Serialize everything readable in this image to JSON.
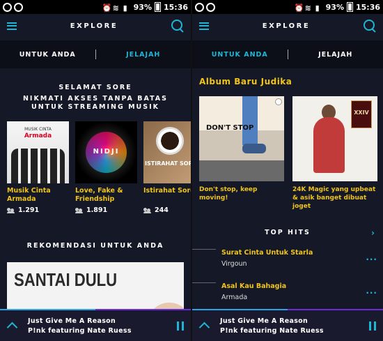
{
  "status_bar": {
    "battery": "93%",
    "time": "15:36"
  },
  "colors": {
    "accent": "#1fb6d6",
    "highlight": "#f0c419",
    "background": "#151826",
    "player_border": "#6c2cd8"
  },
  "left": {
    "topbar": {
      "title": "EXPLORE"
    },
    "tabs": [
      {
        "label": "UNTUK ANDA",
        "active": true
      },
      {
        "label": "JELAJAH",
        "active": false
      }
    ],
    "greeting": {
      "line1": "SELAMAT SORE",
      "line2": "NIKMATI AKSES TANPA BATAS UNTUK STREAMING MUSIK"
    },
    "playlists": [
      {
        "title": "Musik Cinta Armada",
        "followers": "1.291",
        "cover_text": "MUSIK CINTA",
        "cover_logo": "Armada"
      },
      {
        "title": "Love, Fake & Friendship",
        "followers": "1.891",
        "cover_text": "NIDJI"
      },
      {
        "title": "Istirahat Sore",
        "followers": "244",
        "cover_text": "ISTIRAHAT SORE"
      }
    ],
    "recommend": {
      "title": "REKOMENDASI UNTUK ANDA",
      "banner_text": "SANTAI DULU"
    }
  },
  "right": {
    "topbar": {
      "title": "EXPLORE"
    },
    "tabs": [
      {
        "label": "UNTUK ANDA",
        "active": false
      },
      {
        "label": "JELAJAH",
        "active": true
      }
    ],
    "album_heading": "Album  Baru Judika",
    "albums": [
      {
        "title": "Don't stop, keep moving!",
        "cover_text": "DON'T STOP"
      },
      {
        "title": "24K Magic yang upbeat & asik banget dibuat joget",
        "cover_text": "XXIV"
      }
    ],
    "top_hits": {
      "title": "TOP HITS",
      "tracks": [
        {
          "title": "Surat Cinta Untuk Starla",
          "artist": "Virgoun"
        },
        {
          "title": "Asal Kau Bahagia",
          "artist": "Armada"
        }
      ]
    }
  },
  "player": {
    "song": "Just Give Me A Reason",
    "artist": "P!nk featuring Nate Ruess",
    "progress": 0.5
  }
}
